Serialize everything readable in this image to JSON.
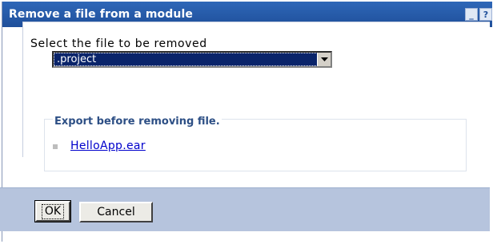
{
  "window": {
    "title": "Remove a file from a module",
    "controls": {
      "minimize_glyph": "_",
      "help_glyph": "?"
    }
  },
  "form": {
    "select_label": "Select the file to be removed",
    "selected_file": ".project",
    "section_legend": "Export before removing file.",
    "export_link": "HelloApp.ear"
  },
  "buttons": {
    "ok_label": "OK",
    "cancel_label": "Cancel"
  },
  "colors": {
    "titlebar": "#2e67b8",
    "footer": "#b6c4dd",
    "selection": "#0a246a",
    "link": "#0000cc",
    "legend": "#2d4f85"
  },
  "icons": {
    "minimize": "minimize-icon",
    "help": "help-icon",
    "dropdown": "chevron-down-icon",
    "bullet": "square-bullet-icon"
  }
}
